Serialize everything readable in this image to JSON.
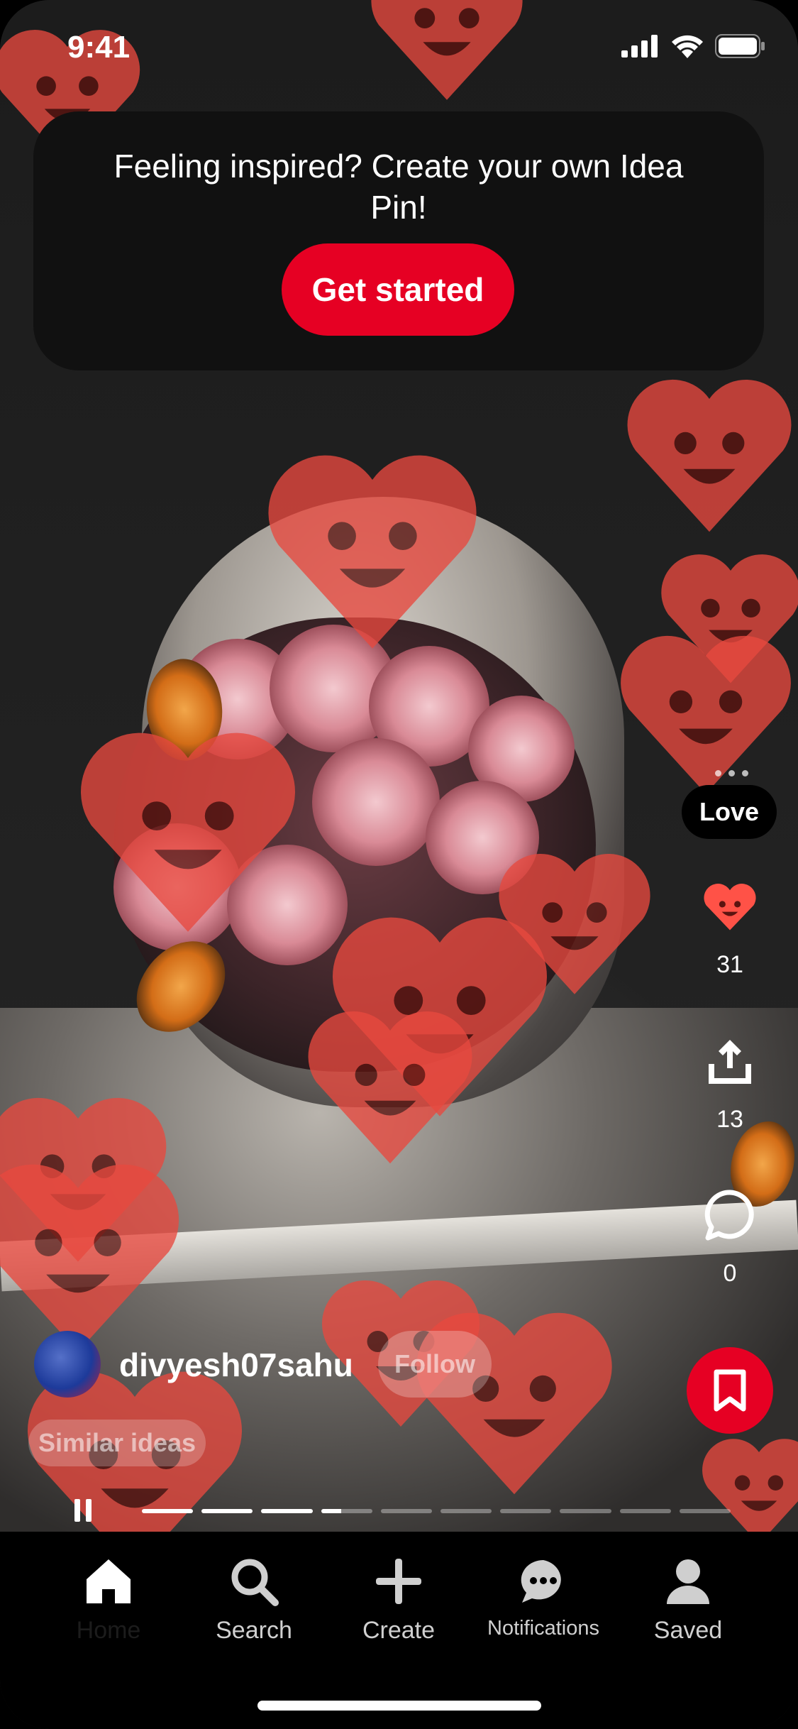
{
  "status_bar": {
    "time": "9:41"
  },
  "banner": {
    "message": "Feeling inspired? Create your own Idea Pin!",
    "cta_label": "Get started"
  },
  "actions": {
    "reaction_label": "Love",
    "reaction_count": "31",
    "share_count": "13",
    "comment_count": "0"
  },
  "creator": {
    "username": "divyesh07sahu",
    "follow_label": "Follow"
  },
  "similar_label": "Similar ideas",
  "story_progress": {
    "segments": 10,
    "completed": 3,
    "current_fraction": 0.4
  },
  "tabbar": {
    "items": [
      {
        "label": "Home",
        "icon": "home-icon",
        "active": true
      },
      {
        "label": "Search",
        "icon": "search-icon",
        "active": false
      },
      {
        "label": "Create",
        "icon": "plus-icon",
        "active": false
      },
      {
        "label": "Notifications",
        "icon": "chat-bubble-icon",
        "active": false
      },
      {
        "label": "Saved",
        "icon": "profile-icon",
        "active": false
      }
    ]
  },
  "colors": {
    "brand_red": "#e60023",
    "heart_red": "#e8493f"
  }
}
